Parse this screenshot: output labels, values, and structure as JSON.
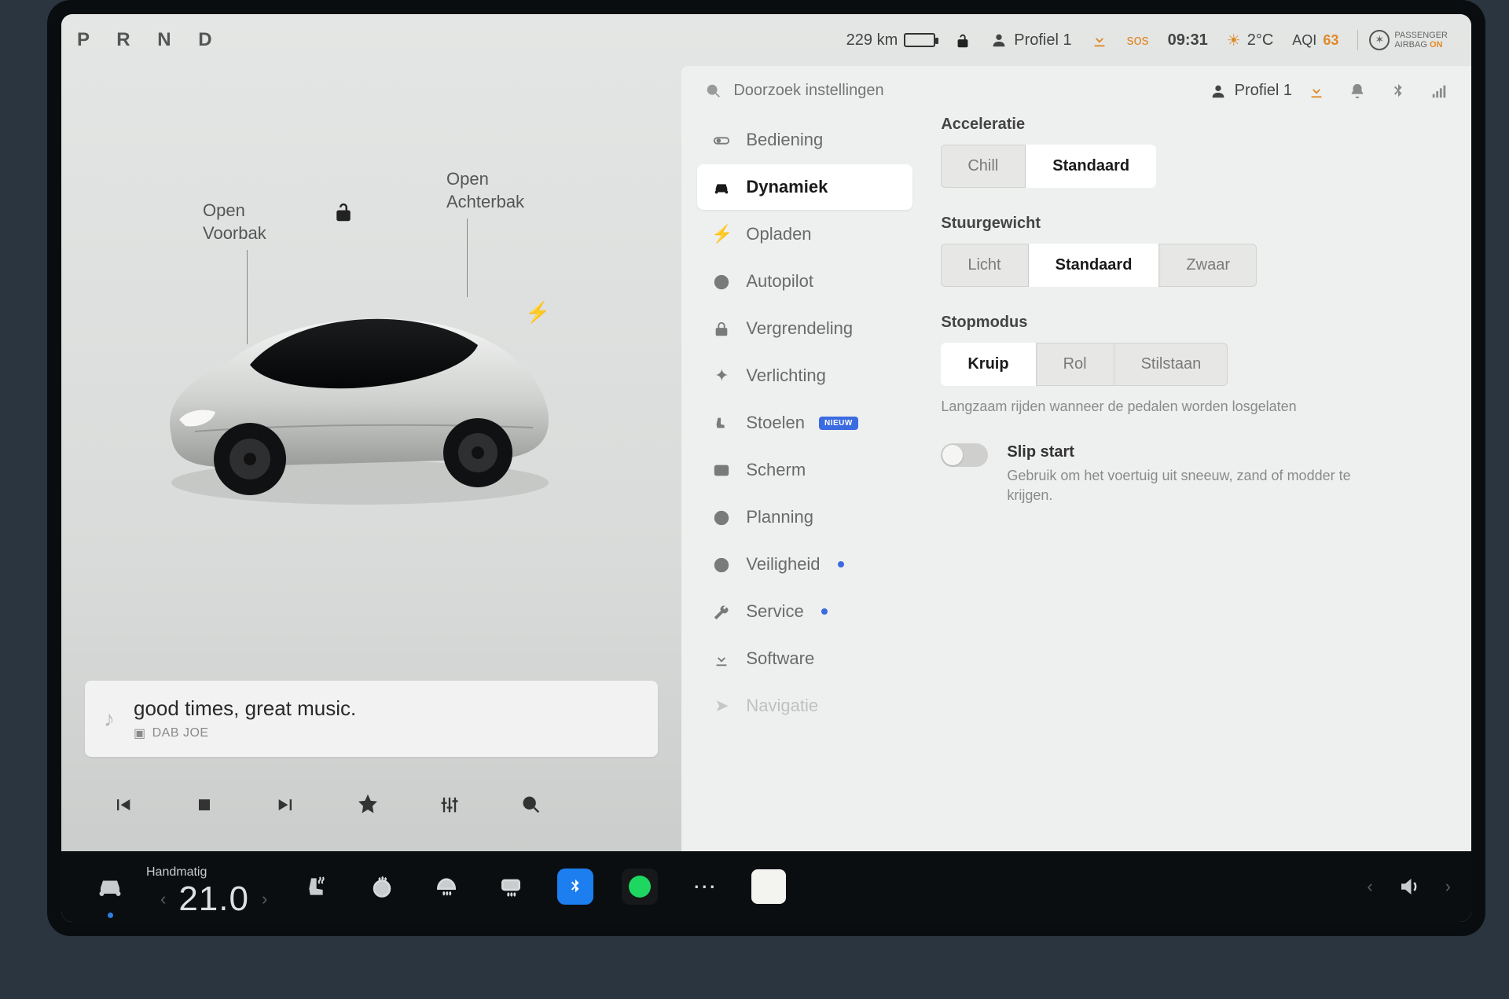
{
  "status": {
    "gears": "P R N D",
    "range": "229 km",
    "profile": "Profiel 1",
    "sos": "sos",
    "time": "09:31",
    "temp": "2°C",
    "aqi_label": "AQI",
    "aqi_value": "63",
    "airbag_line1": "PASSENGER",
    "airbag_line2": "AIRBAG",
    "airbag_state": "ON"
  },
  "car_labels": {
    "frunk_line1": "Open",
    "frunk_line2": "Voorbak",
    "trunk_line1": "Open",
    "trunk_line2": "Achterbak"
  },
  "media": {
    "title": "good times, great music.",
    "source": "DAB JOE"
  },
  "right_header": {
    "search_placeholder": "Doorzoek instellingen",
    "profile": "Profiel 1"
  },
  "nav": {
    "items": [
      "Bediening",
      "Dynamiek",
      "Opladen",
      "Autopilot",
      "Vergrendeling",
      "Verlichting",
      "Stoelen",
      "Scherm",
      "Planning",
      "Veiligheid",
      "Service",
      "Software",
      "Navigatie"
    ],
    "new_badge": "NIEUW"
  },
  "settings": {
    "accel": {
      "title": "Acceleratie",
      "options": [
        "Chill",
        "Standaard"
      ],
      "selected": "Standaard"
    },
    "steering": {
      "title": "Stuurgewicht",
      "options": [
        "Licht",
        "Standaard",
        "Zwaar"
      ],
      "selected": "Standaard"
    },
    "stopmode": {
      "title": "Stopmodus",
      "options": [
        "Kruip",
        "Rol",
        "Stilstaan"
      ],
      "selected": "Kruip",
      "help": "Langzaam rijden wanneer de pedalen worden losgelaten"
    },
    "slipstart": {
      "title": "Slip start",
      "desc": "Gebruik om het voertuig uit sneeuw, zand of modder te krijgen."
    }
  },
  "bottom": {
    "mode_label": "Handmatig",
    "temperature": "21.0"
  }
}
